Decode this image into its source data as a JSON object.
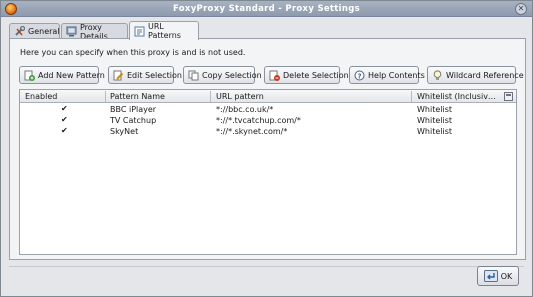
{
  "window": {
    "title": "FoxyProxy Standard - Proxy Settings"
  },
  "tabs": [
    {
      "label": "General",
      "icon": "tools-icon",
      "active": false
    },
    {
      "label": "Proxy Details",
      "icon": "proxy-details-icon",
      "active": false
    },
    {
      "label": "URL Patterns",
      "icon": "url-patterns-icon",
      "active": true
    }
  ],
  "main": {
    "intro_text": "Here you can specify when this proxy is and is not used.",
    "toolbar": {
      "add_new_pattern": "Add New Pattern",
      "edit_selection": "Edit Selection",
      "copy_selection": "Copy Selection",
      "delete_selection": "Delete Selection",
      "help_contents": "Help Contents",
      "wildcard_reference": "Wildcard Reference"
    },
    "table": {
      "columns": [
        "Enabled",
        "Pattern Name",
        "URL pattern",
        "Whitelist (Inclusiv…"
      ],
      "rows": [
        {
          "enabled": "✔",
          "name": "BBC iPlayer",
          "pattern": "*://bbc.co.uk/*",
          "type": "Whitelist"
        },
        {
          "enabled": "✔",
          "name": "TV Catchup",
          "pattern": "*://*.tvcatchup.com/*",
          "type": "Whitelist"
        },
        {
          "enabled": "✔",
          "name": "SkyNet",
          "pattern": "*://*.skynet.com/*",
          "type": "Whitelist"
        }
      ]
    }
  },
  "footer": {
    "ok_label": "OK"
  },
  "colors": {
    "titlebar": "#9aa6b7",
    "window_bg": "#e4e6ea",
    "panel_bg": "#f3f4f6"
  }
}
